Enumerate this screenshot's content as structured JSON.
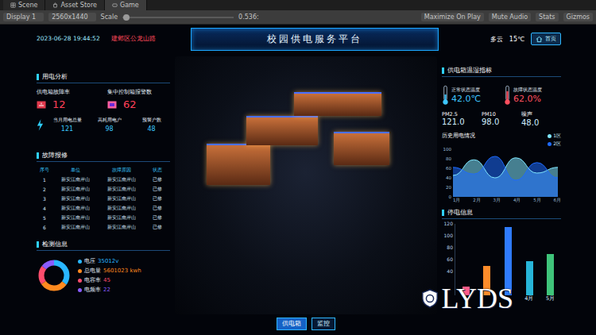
{
  "editor": {
    "tabs": [
      {
        "label": "Scene",
        "selected": false
      },
      {
        "label": "Asset Store",
        "selected": false
      },
      {
        "label": "Game",
        "selected": true
      }
    ],
    "toolbar": {
      "display": "Display 1",
      "resolution": "2560x1440",
      "scale_label": "Scale",
      "scale_level": 0.02,
      "scale_value": "0.536:",
      "buttons": [
        {
          "label": "Maximize On Play",
          "selected": false
        },
        {
          "label": "Mute Audio",
          "selected": false
        },
        {
          "label": "Stats",
          "selected": false
        },
        {
          "label": "Gizmos",
          "selected": false
        }
      ]
    }
  },
  "dashboard": {
    "datetime": "2023-06-28 19:44:52",
    "location": "建邺区公龙山路",
    "title": "校园供电服务平台",
    "weather": "多云",
    "temperature": "15℃",
    "home_button": "首页",
    "power_analysis": {
      "title": "用电分析",
      "alarms": [
        {
          "label": "供电箱故障率",
          "value": "12"
        },
        {
          "label": "集中控制箱报警数",
          "value": "62"
        }
      ],
      "stats": [
        {
          "label": "当月用电总量",
          "value": "121"
        },
        {
          "label": "高耗用电户",
          "value": "98"
        },
        {
          "label": "预警户数",
          "value": "48"
        }
      ]
    },
    "fault_repair": {
      "title": "故障报修",
      "columns": [
        "序号",
        "单位",
        "故障原因",
        "状态"
      ],
      "rows": [
        [
          "1",
          "新安江南岸山",
          "新安江南岸山",
          "已修"
        ],
        [
          "2",
          "新安江南岸山",
          "新安江南岸山",
          "已修"
        ],
        [
          "3",
          "新安江南岸山",
          "新安江南岸山",
          "已修"
        ],
        [
          "4",
          "新安江南岸山",
          "新安江南岸山",
          "已修"
        ],
        [
          "5",
          "新安江南岸山",
          "新安江南岸山",
          "已修"
        ],
        [
          "6",
          "新安江南岸山",
          "新安江南岸山",
          "已修"
        ]
      ]
    },
    "monitoring": {
      "title": "检测信息",
      "items": [
        {
          "label": "电压",
          "value": "35012v",
          "level": 0.35,
          "color": "#29b6ff"
        },
        {
          "label": "总电量",
          "value": "5601023 kwh",
          "level": 0.3,
          "color": "#ff8a1f"
        },
        {
          "label": "电容率",
          "value": "45",
          "level": 0.2,
          "color": "#ff4d6d"
        },
        {
          "label": "电频率",
          "value": "22",
          "level": 0.15,
          "color": "#8a5cff"
        }
      ]
    },
    "env": {
      "title": "供电箱温湿指标",
      "temps": [
        {
          "label": "正常状态温度",
          "value": "42.0℃",
          "level": 0.45,
          "color": "#3ec6ff"
        },
        {
          "label": "故障状态温度",
          "value": "62.0%",
          "level": 0.7,
          "color": "#ff4f5e"
        }
      ],
      "air": [
        {
          "label": "PM2.5",
          "value": "121.0"
        },
        {
          "label": "PM10",
          "value": "98.0"
        },
        {
          "label": "噪声",
          "value": "48.0"
        }
      ]
    },
    "history": {
      "title": "历史用电情况",
      "y_ticks": [
        "100",
        "80",
        "60",
        "40",
        "20",
        "0"
      ],
      "x_labels": [
        "1月",
        "2月",
        "3月",
        "4月",
        "5月",
        "6月"
      ],
      "series": [
        {
          "name": "1区",
          "color": "#7fe6ff",
          "values": [
            45,
            78,
            40,
            82,
            50,
            62
          ]
        },
        {
          "name": "2区",
          "color": "#1e6bff",
          "values": [
            62,
            48,
            85,
            35,
            72,
            40
          ]
        }
      ]
    },
    "outage": {
      "title": "停电信息",
      "y_ticks": [
        "120",
        "100",
        "80",
        "60",
        "40"
      ],
      "bars": [
        {
          "label": "",
          "value": 15,
          "color": "#ff5c8a"
        },
        {
          "label": "",
          "value": 50,
          "color": "#ff8c2a"
        },
        {
          "label": "",
          "value": 115,
          "color": "#2f7bff"
        },
        {
          "label": "4月",
          "value": 58,
          "color": "#27b5d8"
        },
        {
          "label": "5月",
          "value": 70,
          "color": "#3fc47a"
        }
      ]
    },
    "bottom_tabs": [
      {
        "label": "供电箱",
        "selected": true
      },
      {
        "label": "监控",
        "selected": false
      }
    ],
    "watermark": "LYDS"
  }
}
